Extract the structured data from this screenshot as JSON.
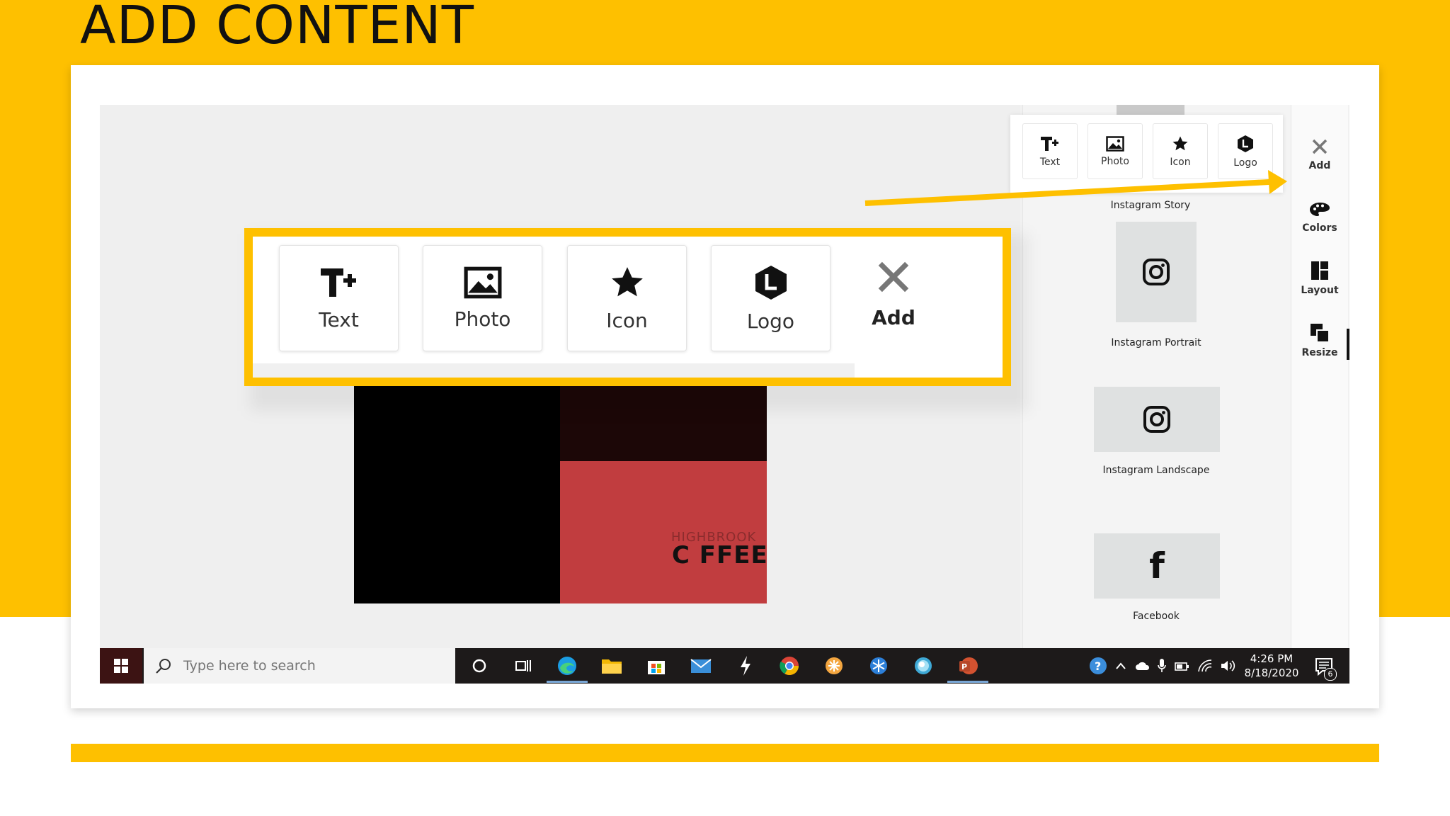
{
  "slide": {
    "title": "ADD CONTENT"
  },
  "zoom": {
    "buttons": [
      {
        "label": "Text",
        "icon": "text-add-icon"
      },
      {
        "label": "Photo",
        "icon": "photo-icon"
      },
      {
        "label": "Icon",
        "icon": "star-icon"
      },
      {
        "label": "Logo",
        "icon": "logo-hexagon-icon"
      }
    ],
    "add_label": "Add"
  },
  "toolstrip": {
    "buttons": [
      {
        "label": "Text"
      },
      {
        "label": "Photo"
      },
      {
        "label": "Icon"
      },
      {
        "label": "Logo"
      }
    ]
  },
  "templates": [
    {
      "label": "Instagram Story"
    },
    {
      "label": "Instagram Portrait",
      "icon": "instagram-icon"
    },
    {
      "label": "Instagram Landscape",
      "icon": "instagram-icon"
    },
    {
      "label": "Facebook",
      "icon": "facebook-icon"
    }
  ],
  "side_nav": [
    {
      "label": "Add",
      "icon": "close-icon"
    },
    {
      "label": "Colors",
      "icon": "palette-icon"
    },
    {
      "label": "Layout",
      "icon": "layout-icon"
    },
    {
      "label": "Resize",
      "icon": "resize-icon"
    }
  ],
  "canvas": {
    "logo_text": "C FFEE",
    "logo_small": "HIGHBROOK"
  },
  "taskbar": {
    "search_placeholder": "Type here to search",
    "time": "4:26 PM",
    "date": "8/18/2020",
    "notification_count": "6"
  },
  "colors": {
    "accent": "#fec000",
    "taskbar": "#1d1a1a",
    "coffee_red": "#c13d3f"
  }
}
